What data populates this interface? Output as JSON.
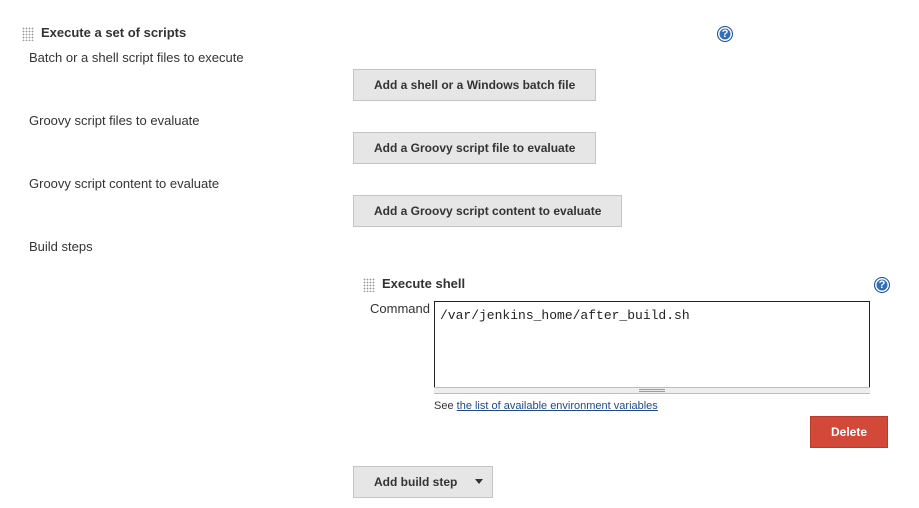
{
  "outer": {
    "title": "Execute a set of scripts",
    "help_icon": "?"
  },
  "fields": {
    "batch_label": "Batch or a shell script files to execute",
    "batch_button": "Add a shell or a Windows batch file",
    "groovy_files_label": "Groovy script files to evaluate",
    "groovy_files_button": "Add a Groovy script file to evaluate",
    "groovy_content_label": "Groovy script content to evaluate",
    "groovy_content_button": "Add a Groovy script content to evaluate",
    "build_steps_label": "Build steps"
  },
  "shell_step": {
    "title": "Execute shell",
    "help_icon": "?",
    "command_label": "Command",
    "command_value": "/var/jenkins_home/after_build.sh",
    "see_text": "See ",
    "env_link": "the list of available environment variables",
    "delete_label": "Delete"
  },
  "add_build_step": {
    "label": "Add build step"
  },
  "colors": {
    "help_icon": "#2f6fbd",
    "delete_button": "#d24939",
    "link": "#204a87"
  }
}
